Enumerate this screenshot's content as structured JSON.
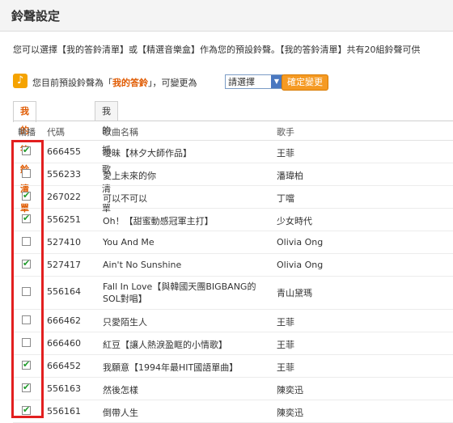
{
  "page_title": "鈴聲設定",
  "description": "您可以選擇【我的答鈴清單】或【精選音樂盒】作為您的預設鈴聲。【我的答鈴清單】共有20組鈴聲可供",
  "default": {
    "prefix": "您目前預設鈴聲為「",
    "current": "我的答鈴",
    "suffix": "」，可變更為",
    "select_value": "請選擇",
    "confirm_label": "確定變更"
  },
  "tabs": [
    {
      "label": "我的答鈴清單"
    },
    {
      "label": "我的抓歌清單"
    }
  ],
  "columns": {
    "play": "輪播",
    "code": "代碼",
    "song": "歌曲名稱",
    "singer": "歌手"
  },
  "rows": [
    {
      "checked": true,
      "code": "666455",
      "song": "曖昧【林夕大師作品】",
      "singer": "王菲"
    },
    {
      "checked": false,
      "code": "556233",
      "song": "愛上未來的你",
      "singer": "潘瑋柏"
    },
    {
      "checked": true,
      "code": "267022",
      "song": "可以不可以",
      "singer": "丁噹"
    },
    {
      "checked": true,
      "code": "556251",
      "song": "Oh！【甜蜜動感冠軍主打】",
      "singer": "少女時代"
    },
    {
      "checked": false,
      "code": "527410",
      "song": "You And Me",
      "singer": "Olivia Ong"
    },
    {
      "checked": true,
      "code": "527417",
      "song": "Ain't No Sunshine",
      "singer": "Olivia Ong"
    },
    {
      "checked": false,
      "code": "556164",
      "song": "Fall In Love【與韓國天團BIGBANG的SOL對唱】",
      "singer": "青山黛瑪"
    },
    {
      "checked": false,
      "code": "666462",
      "song": "只愛陌生人",
      "singer": "王菲"
    },
    {
      "checked": false,
      "code": "666460",
      "song": "紅豆【讓人熱淚盈眶的小情歌】",
      "singer": "王菲"
    },
    {
      "checked": true,
      "code": "666452",
      "song": "我願意【1994年最HIT國語單曲】",
      "singer": "王菲"
    },
    {
      "checked": true,
      "code": "556163",
      "song": "然後怎樣",
      "singer": "陳奕迅"
    },
    {
      "checked": true,
      "code": "556161",
      "song": "倒帶人生",
      "singer": "陳奕迅"
    }
  ]
}
